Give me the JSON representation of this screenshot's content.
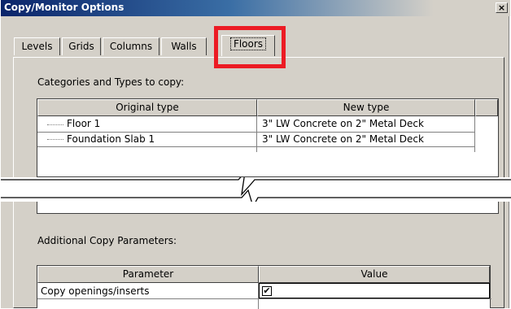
{
  "window": {
    "title": "Copy/Monitor Options",
    "close_glyph": "×"
  },
  "tabs": [
    {
      "label": "Levels"
    },
    {
      "label": "Grids"
    },
    {
      "label": "Columns"
    },
    {
      "label": "Walls"
    },
    {
      "label": "Floors",
      "active": true
    }
  ],
  "types_section": {
    "label": "Categories and Types to copy:",
    "columns": [
      "Original type",
      "New type"
    ],
    "rows": [
      {
        "original": "Floor 1",
        "new": "3\" LW Concrete on 2\" Metal Deck"
      },
      {
        "original": "Foundation Slab 1",
        "new": "3\" LW Concrete on 2\" Metal Deck"
      }
    ]
  },
  "params_section": {
    "label": "Additional Copy Parameters:",
    "columns": [
      "Parameter",
      "Value"
    ],
    "rows": [
      {
        "parameter": "Copy openings/inserts",
        "checked": true,
        "check_glyph": "✔"
      }
    ]
  },
  "colors": {
    "highlight": "#ec1b24",
    "titlebar": "#0a246a"
  }
}
